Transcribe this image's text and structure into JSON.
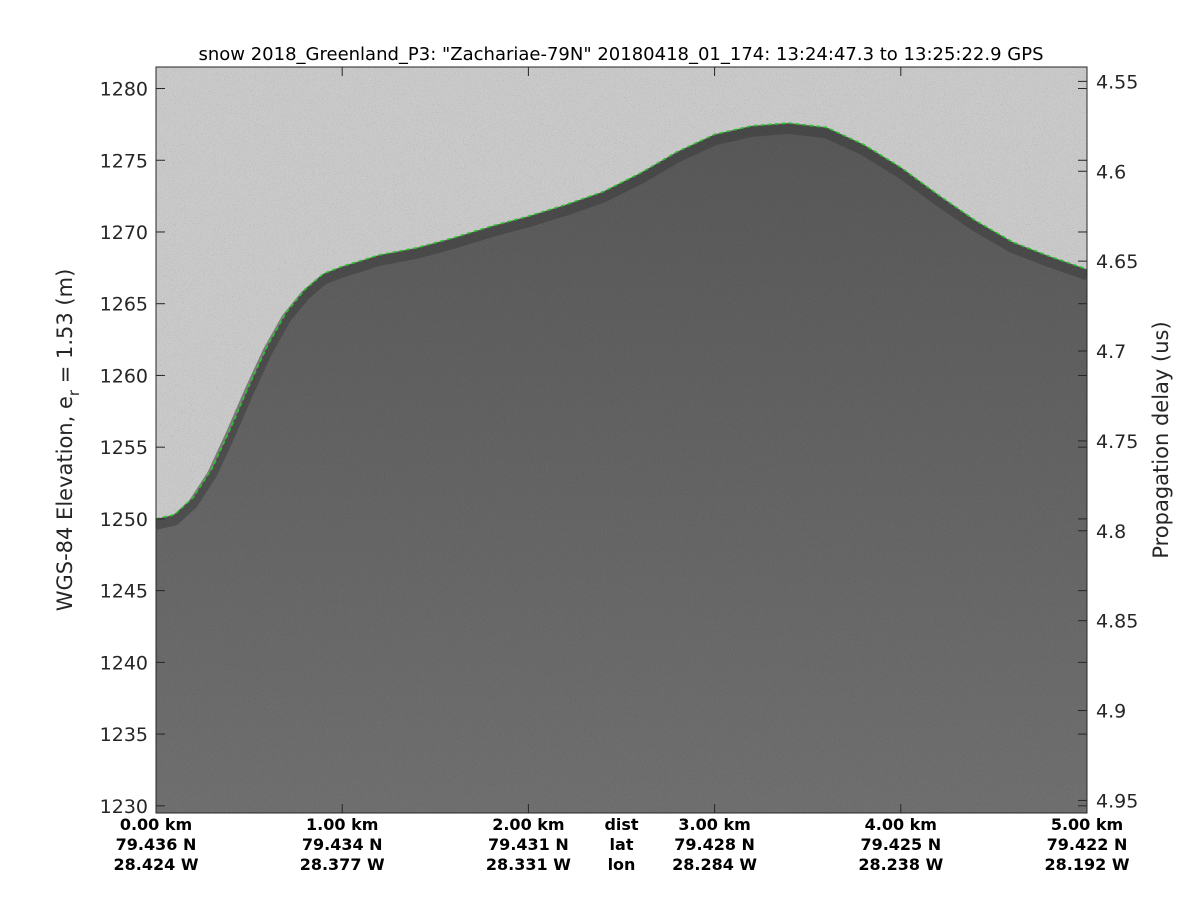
{
  "chart_data": {
    "type": "heatmap",
    "title": "snow 2018_Greenland_P3: \"Zachariae-79N\"  20180418_01_174: 13:24:47.3 to 13:25:22.9 GPS",
    "ylabel_left": "WGS-84 Elevation, e",
    "ylabel_left_sub": "r",
    "ylabel_left_rest": " = 1.53 (m)",
    "ylabel_right": "Propagation delay (us)",
    "ylim": [
      1229.5,
      1281.5
    ],
    "yticks_left": [
      "1280",
      "1275",
      "1270",
      "1265",
      "1260",
      "1255",
      "1250",
      "1245",
      "1240",
      "1235",
      "1230"
    ],
    "ytick_values_left": [
      1280,
      1275,
      1270,
      1265,
      1260,
      1255,
      1250,
      1245,
      1240,
      1235,
      1230
    ],
    "right_axis_range": [
      4.542,
      4.957
    ],
    "yticks_right": [
      "4.55",
      "4.6",
      "4.65",
      "4.7",
      "4.75",
      "4.8",
      "4.85",
      "4.9",
      "4.95"
    ],
    "ytick_values_right": [
      4.55,
      4.6,
      4.65,
      4.7,
      4.75,
      4.8,
      4.85,
      4.9,
      4.95
    ],
    "xlim_km": [
      0,
      5
    ],
    "x_ticks": [
      {
        "dist": "0.00 km",
        "lat": "79.436 N",
        "lon": "28.424 W",
        "value": 0
      },
      {
        "dist": "1.00 km",
        "lat": "79.434 N",
        "lon": "28.377 W",
        "value": 1
      },
      {
        "dist": "2.00 km",
        "lat": "79.431 N",
        "lon": "28.331 W",
        "value": 2
      },
      {
        "dist": "3.00 km",
        "lat": "79.428 N",
        "lon": "28.284 W",
        "value": 3
      },
      {
        "dist": "4.00 km",
        "lat": "79.425 N",
        "lon": "28.238 W",
        "value": 4
      },
      {
        "dist": "5.00 km",
        "lat": "79.422 N",
        "lon": "28.192 W",
        "value": 5
      }
    ],
    "row_labels": {
      "dist": "dist",
      "lat": "lat",
      "lon": "lon"
    },
    "surface_line": {
      "color": "#2dc42d",
      "style": "dashed",
      "x_km": [
        0.0,
        0.1,
        0.2,
        0.3,
        0.4,
        0.5,
        0.6,
        0.7,
        0.8,
        0.9,
        1.0,
        1.1,
        1.2,
        1.4,
        1.6,
        1.8,
        2.0,
        2.2,
        2.4,
        2.6,
        2.8,
        3.0,
        3.2,
        3.4,
        3.6,
        3.8,
        4.0,
        4.2,
        4.4,
        4.6,
        4.8,
        5.0
      ],
      "elev_m": [
        1250.0,
        1250.3,
        1251.5,
        1253.5,
        1256.3,
        1259.3,
        1262.1,
        1264.4,
        1266.0,
        1267.1,
        1267.6,
        1268.0,
        1268.4,
        1268.9,
        1269.6,
        1270.4,
        1271.1,
        1271.9,
        1272.8,
        1274.1,
        1275.6,
        1276.8,
        1277.4,
        1277.6,
        1277.3,
        1276.1,
        1274.5,
        1272.6,
        1270.8,
        1269.3,
        1268.3,
        1267.4
      ]
    },
    "colors": {
      "above_surface": "#cacaca",
      "below_surface": "#5b5b5b",
      "deep": "#6a6a6a",
      "frame": "#262626"
    },
    "grid": false,
    "legend": "none"
  }
}
